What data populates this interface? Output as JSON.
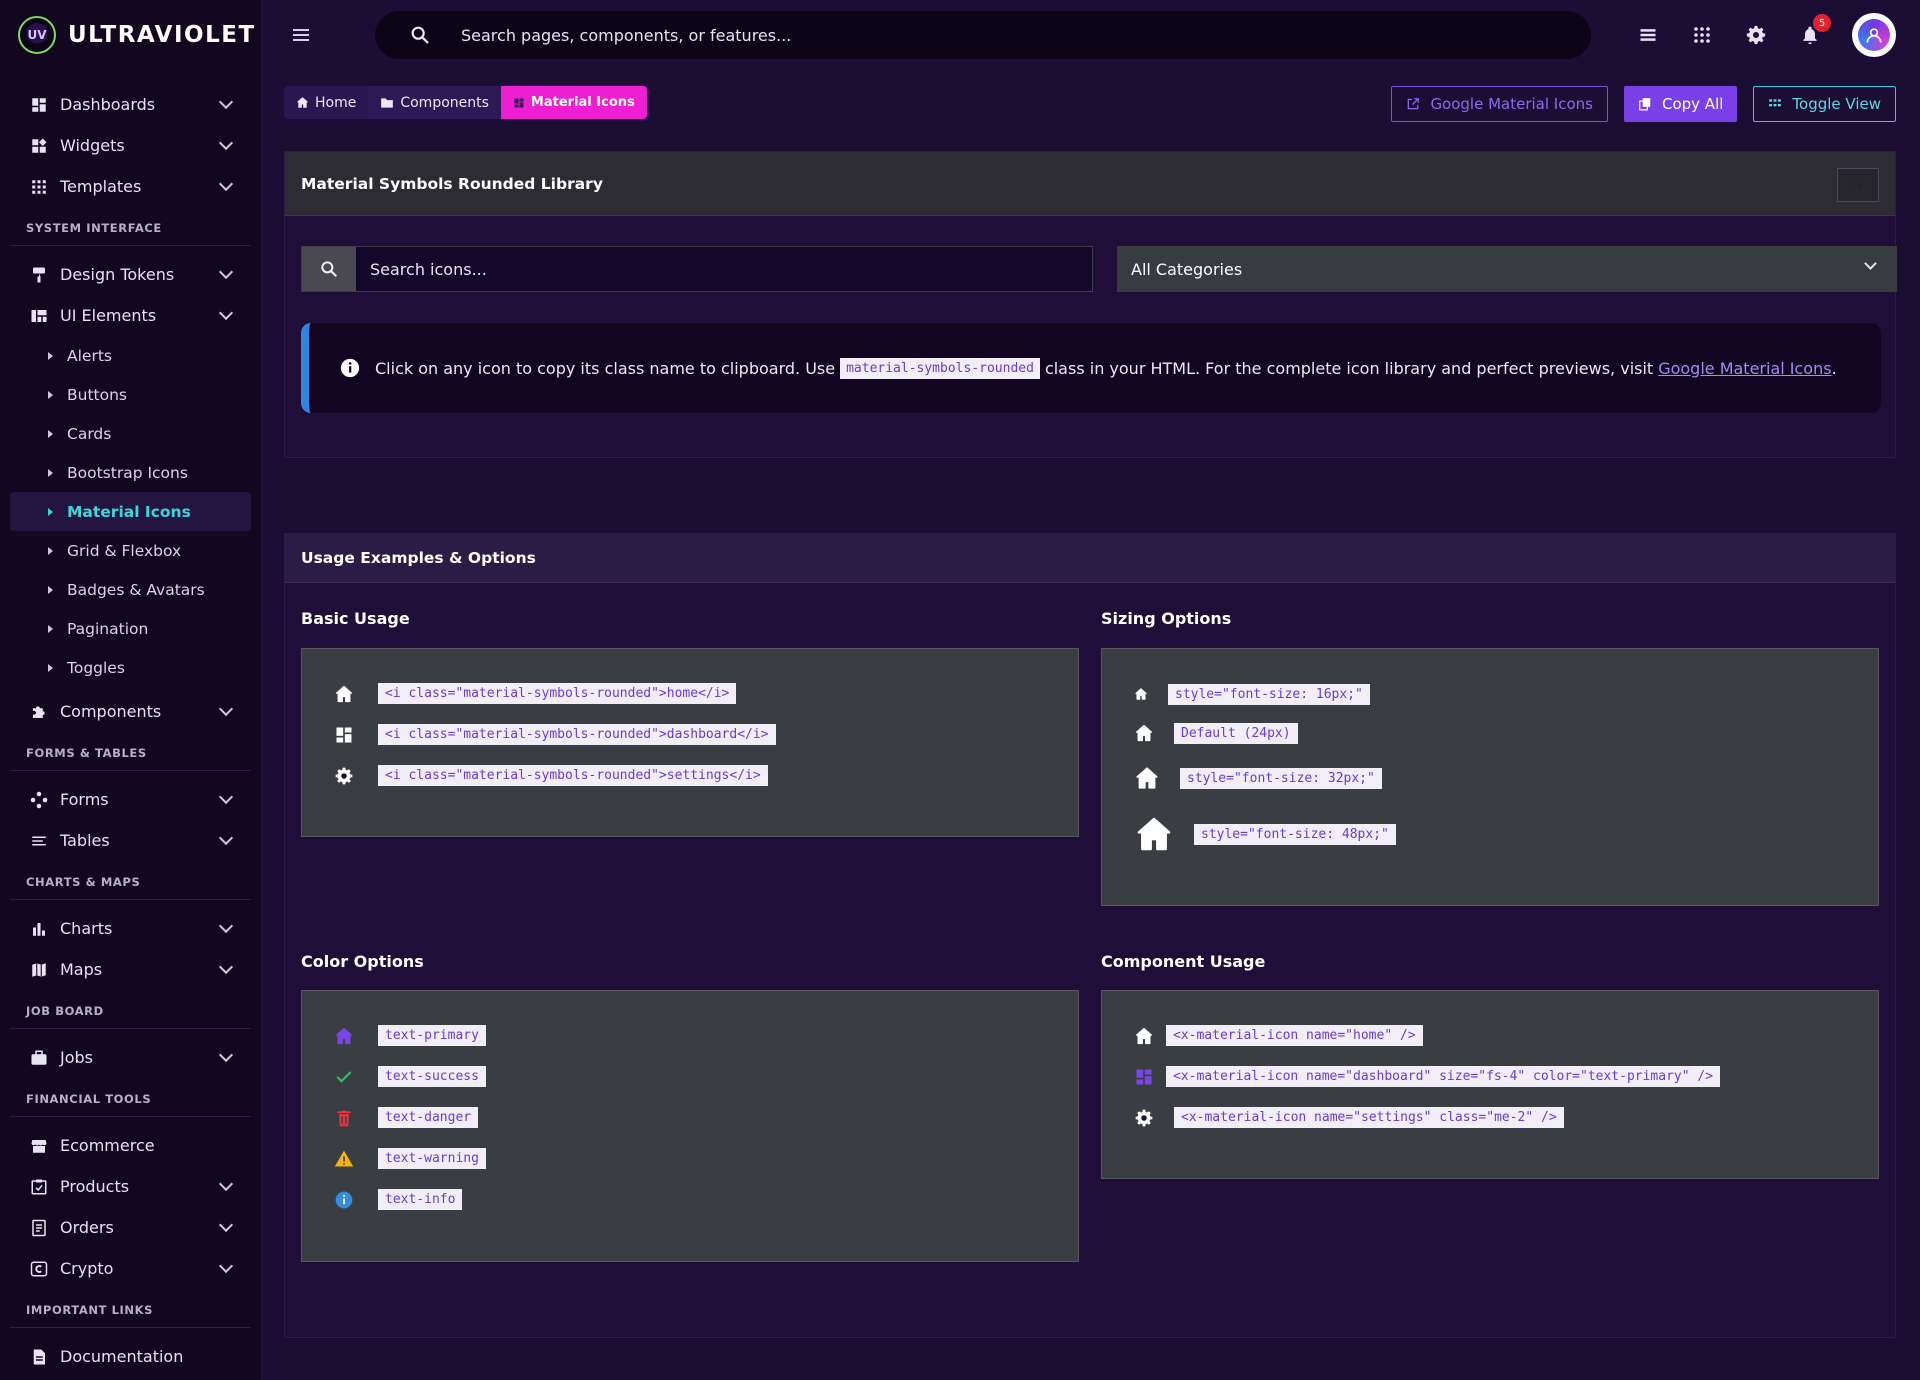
{
  "brand": {
    "name": "ULTRAVIOLET",
    "logo_text": "UV"
  },
  "sidebar": {
    "groups": [
      {
        "items": [
          {
            "label": "Dashboards",
            "icon": "dashboard-icon",
            "chevron": true
          },
          {
            "label": "Widgets",
            "icon": "widgets-icon",
            "chevron": true
          },
          {
            "label": "Templates",
            "icon": "apps-icon",
            "chevron": true
          }
        ]
      },
      {
        "section": "SYSTEM INTERFACE",
        "items": [
          {
            "label": "Design Tokens",
            "icon": "format-paint-icon",
            "chevron": true
          },
          {
            "label": "UI Elements",
            "icon": "view-quilt-icon",
            "chevron": true
          }
        ]
      }
    ],
    "ui_sub": [
      "Alerts",
      "Buttons",
      "Cards",
      "Bootstrap Icons",
      "Material Icons",
      "Grid & Flexbox",
      "Badges & Avatars",
      "Pagination",
      "Toggles"
    ],
    "active_sub": "Material Icons",
    "components": "Components",
    "sec_forms": "FORMS & TABLES",
    "forms": "Forms",
    "tables": "Tables",
    "sec_charts": "CHARTS & MAPS",
    "charts": "Charts",
    "maps": "Maps",
    "sec_job": "JOB BOARD",
    "jobs": "Jobs",
    "sec_fin": "FINANCIAL TOOLS",
    "ecommerce": "Ecommerce",
    "products": "Products",
    "orders": "Orders",
    "crypto": "Crypto",
    "sec_links": "IMPORTANT LINKS",
    "documentation": "Documentation"
  },
  "topbar": {
    "search_placeholder": "Search pages, components, or features...",
    "notification_count": "5"
  },
  "breadcrumb": {
    "home": "Home",
    "components": "Components",
    "current": "Material Icons"
  },
  "actions": {
    "google": "Google Material Icons",
    "copy_all": "Copy All",
    "toggle_view": "Toggle View"
  },
  "library": {
    "title": "Material Symbols Rounded Library",
    "search_placeholder": "Search icons...",
    "category": "All Categories",
    "alert_pre": "Click on any icon to copy its class name to clipboard. Use",
    "alert_code": "material-symbols-rounded",
    "alert_mid": "class in your HTML. For the complete icon library and perfect previews, visit",
    "alert_link": "Google Material Icons",
    "alert_end": "."
  },
  "usage": {
    "title": "Usage Examples & Options",
    "basic_title": "Basic Usage",
    "basic": [
      "<i class=\"material-symbols-rounded\">home</i>",
      "<i class=\"material-symbols-rounded\">dashboard</i>",
      "<i class=\"material-symbols-rounded\">settings</i>"
    ],
    "sizing_title": "Sizing Options",
    "sizing": [
      "style=\"font-size: 16px;\"",
      "Default (24px)",
      "style=\"font-size: 32px;\"",
      "style=\"font-size: 48px;\""
    ],
    "color_title": "Color Options",
    "colors": [
      "text-primary",
      "text-success",
      "text-danger",
      "text-warning",
      "text-info"
    ],
    "color_hex": {
      "primary": "#7a45e6",
      "success": "#27c16a",
      "danger": "#e0353f",
      "warning": "#f3b50c",
      "info": "#2f8de6"
    },
    "component_title": "Component Usage",
    "component": [
      "<x-material-icon name=\"home\" />",
      "<x-material-icon name=\"dashboard\" size=\"fs-4\" color=\"text-primary\" />",
      "<x-material-icon name=\"settings\" class=\"me-2\" />"
    ]
  }
}
